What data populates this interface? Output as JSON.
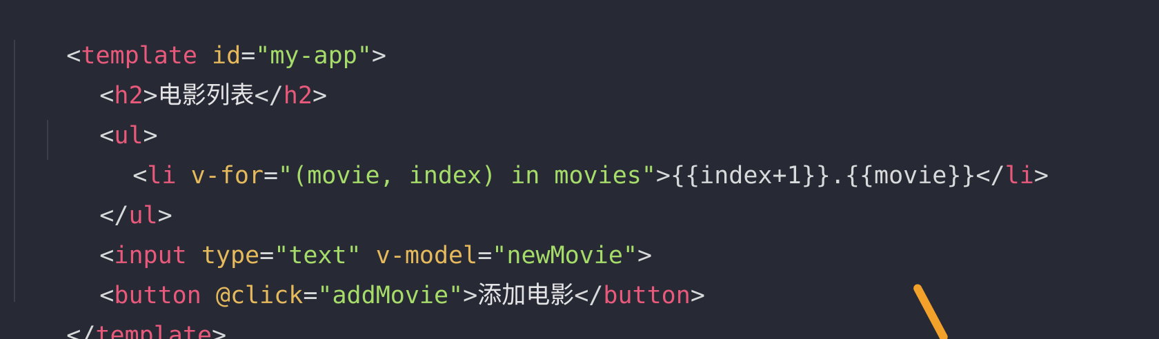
{
  "code": {
    "line1": {
      "open": "<",
      "tag": "template",
      "attr": "id",
      "eq": "=",
      "value": "\"my-app\"",
      "close": ">"
    },
    "line2": {
      "open": "<",
      "tag": "h2",
      "close": ">",
      "text": "电影列表",
      "end_open": "</",
      "end_tag": "h2",
      "end_close": ">"
    },
    "line3": {
      "open": "<",
      "tag": "ul",
      "close": ">"
    },
    "line4": {
      "open": "<",
      "tag": "li",
      "attr": "v-for",
      "eq": "=",
      "value": "\"(movie, index) in movies\"",
      "close": ">",
      "text": "{{index+1}}.{{movie}}",
      "end_open": "</",
      "end_tag": "li",
      "end_close": ">"
    },
    "line5": {
      "open": "</",
      "tag": "ul",
      "close": ">"
    },
    "line6": {
      "open": "<",
      "tag": "input",
      "attr1": "type",
      "eq1": "=",
      "value1": "\"text\"",
      "attr2": "v-model",
      "eq2": "=",
      "value2": "\"newMovie\"",
      "close": ">"
    },
    "line7": {
      "open": "<",
      "tag": "button",
      "attr": "@click",
      "eq": "=",
      "value": "\"addMovie\"",
      "close": ">",
      "text": "添加电影",
      "end_open": "</",
      "end_tag": "button",
      "end_close": ">"
    },
    "line8": {
      "open": "</",
      "tag": "template",
      "close": ">"
    }
  },
  "colors": {
    "background": "#272a34",
    "tag": "#e9597b",
    "attribute": "#e5b95c",
    "string": "#a6dc6a",
    "text": "#d8d9db",
    "pointer": "#f2a12a"
  }
}
